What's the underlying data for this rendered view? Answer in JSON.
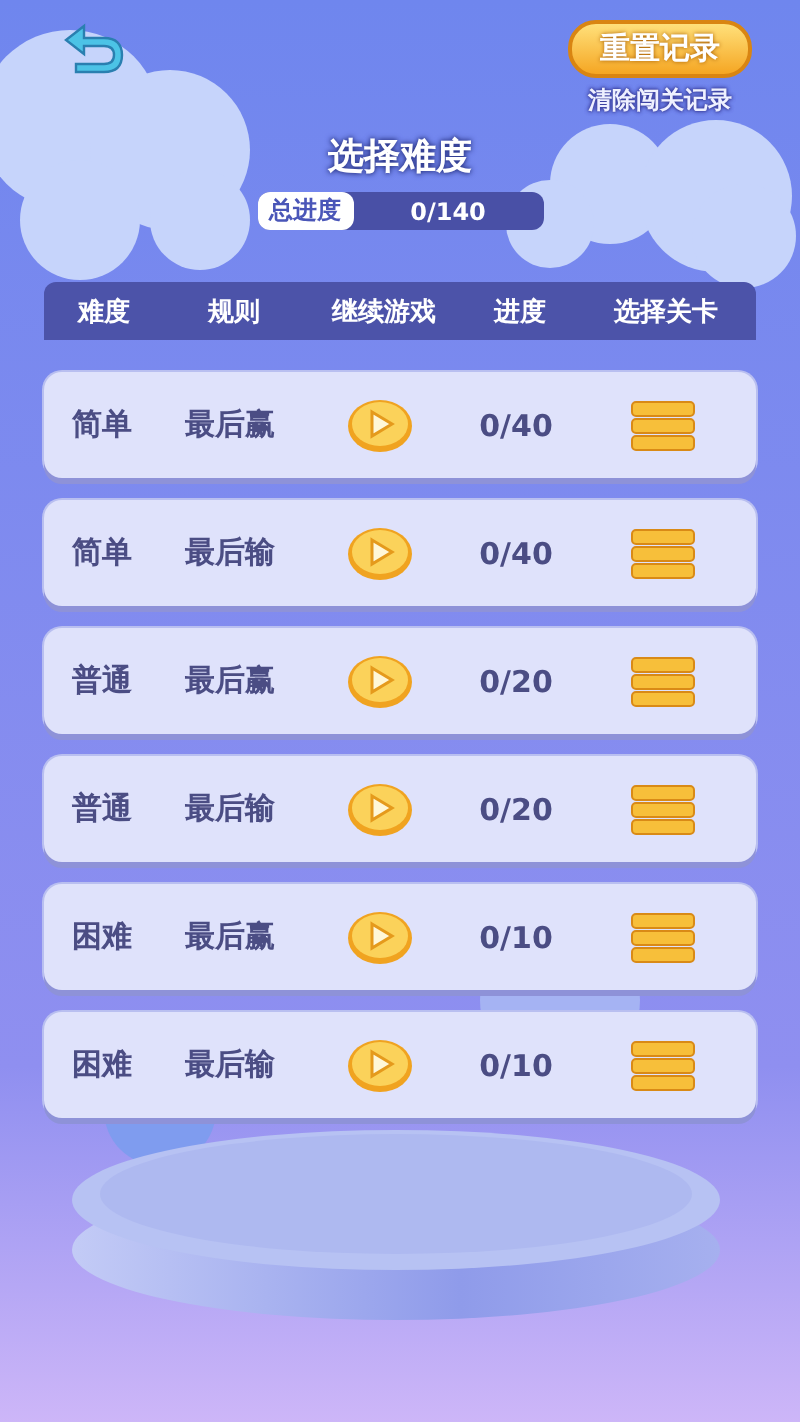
{
  "top_bar": {
    "reset_button": "重置记录",
    "reset_hint": "清除闯关记录"
  },
  "title": "选择难度",
  "total_progress": {
    "label": "总进度",
    "value": "0/140",
    "level": 0
  },
  "table": {
    "columns": [
      "难度",
      "规则",
      "继续游戏",
      "进度",
      "选择关卡"
    ],
    "rows": [
      {
        "difficulty": "简单",
        "rule": "最后赢",
        "progress": "0/40"
      },
      {
        "difficulty": "简单",
        "rule": "最后输",
        "progress": "0/40"
      },
      {
        "difficulty": "普通",
        "rule": "最后赢",
        "progress": "0/20"
      },
      {
        "difficulty": "普通",
        "rule": "最后输",
        "progress": "0/20"
      },
      {
        "difficulty": "困难",
        "rule": "最后赢",
        "progress": "0/10"
      },
      {
        "difficulty": "困难",
        "rule": "最后输",
        "progress": "0/10"
      }
    ]
  }
}
